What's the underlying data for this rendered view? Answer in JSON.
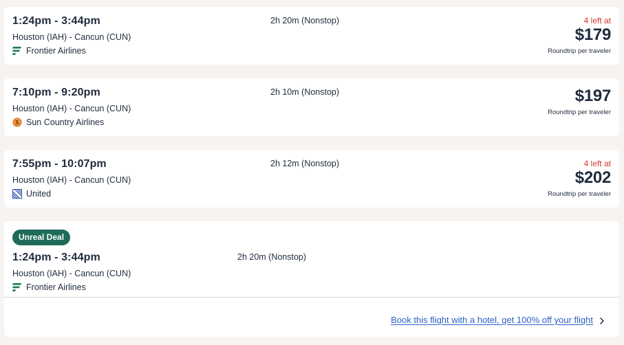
{
  "flights": [
    {
      "time_range": "1:24pm - 3:44pm",
      "route": "Houston (IAH) - Cancun (CUN)",
      "airline": "Frontier Airlines",
      "airline_icon": "frontier-logo-icon",
      "duration": "2h 20m (Nonstop)",
      "seats_left": "4 left at",
      "price": "$179",
      "price_note": "Roundtrip per traveler"
    },
    {
      "time_range": "7:10pm - 9:20pm",
      "route": "Houston (IAH) - Cancun (CUN)",
      "airline": "Sun Country Airlines",
      "airline_icon": "sun-country-logo-icon",
      "duration": "2h 10m (Nonstop)",
      "price": "$197",
      "price_note": "Roundtrip per traveler"
    },
    {
      "time_range": "7:55pm - 10:07pm",
      "route": "Houston (IAH) - Cancun (CUN)",
      "airline": "United",
      "airline_icon": "united-logo-icon",
      "duration": "2h 12m (Nonstop)",
      "seats_left": "4 left at",
      "price": "$202",
      "price_note": "Roundtrip per traveler"
    },
    {
      "badge": "Unreal Deal",
      "time_range": "1:24pm - 3:44pm",
      "route": "Houston (IAH) - Cancun (CUN)",
      "airline": "Frontier Airlines",
      "airline_icon": "frontier-logo-icon",
      "duration": "2h 20m (Nonstop)",
      "promo_link": "Book this flight with a hotel, get 100% off your flight"
    }
  ],
  "colors": {
    "page_background": "#f6f3f1",
    "card_background": "#ffffff",
    "text": "#1f2b3d",
    "seats_left": "#d23a2a",
    "badge": "#1f6b5a",
    "link": "#2a5fc7",
    "frontier_green": "#1e7a55",
    "sun_country_orange": "#e8742a",
    "united_blue": "#2d4fa8"
  }
}
